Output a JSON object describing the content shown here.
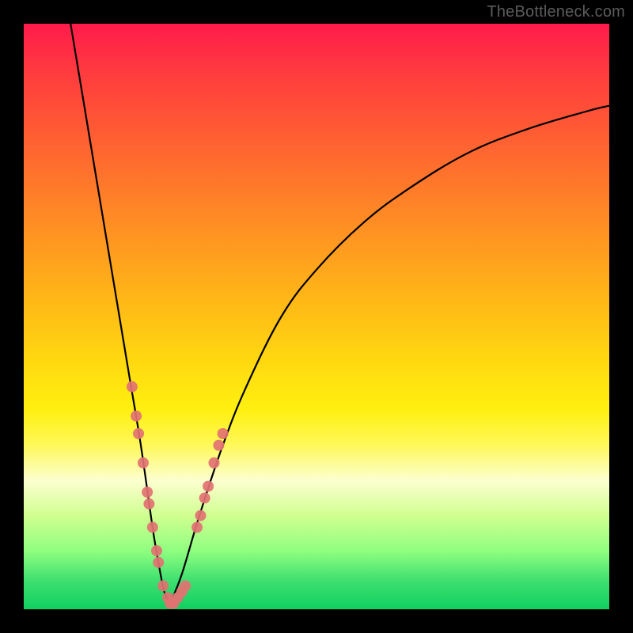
{
  "watermark": "TheBottleneck.com",
  "colors": {
    "frame": "#000000",
    "curve": "#000000",
    "markers": "#e27272",
    "gradient_top": "#ff1b4b",
    "gradient_bottom": "#10d060"
  },
  "chart_data": {
    "type": "line",
    "title": "",
    "xlabel": "",
    "ylabel": "",
    "xlim": [
      0,
      100
    ],
    "ylim": [
      0,
      100
    ],
    "notes": "Two curved branches meeting near a minimum around x≈25; right branch rises and flattens; left branch rises sharply. Pinkish markers cluster on both branches near the minimum, roughly where y is between 2 and 30.",
    "series": [
      {
        "name": "left-branch",
        "x": [
          8,
          10,
          12,
          14,
          16,
          18,
          20,
          22,
          23,
          24,
          25
        ],
        "values": [
          100,
          88,
          76,
          64,
          52,
          40,
          28,
          14,
          8,
          3,
          1
        ]
      },
      {
        "name": "right-branch",
        "x": [
          25,
          27,
          30,
          34,
          38,
          44,
          50,
          58,
          66,
          76,
          86,
          96,
          100
        ],
        "values": [
          1,
          6,
          16,
          28,
          38,
          50,
          58,
          66,
          72,
          78,
          82,
          85,
          86
        ]
      }
    ],
    "markers": [
      {
        "x": 18.5,
        "y": 38
      },
      {
        "x": 19.2,
        "y": 33
      },
      {
        "x": 19.6,
        "y": 30
      },
      {
        "x": 20.4,
        "y": 25
      },
      {
        "x": 21.1,
        "y": 20
      },
      {
        "x": 21.4,
        "y": 18
      },
      {
        "x": 22.0,
        "y": 14
      },
      {
        "x": 22.7,
        "y": 10
      },
      {
        "x": 23.0,
        "y": 8
      },
      {
        "x": 23.8,
        "y": 4
      },
      {
        "x": 24.6,
        "y": 2
      },
      {
        "x": 25.0,
        "y": 1
      },
      {
        "x": 25.6,
        "y": 1
      },
      {
        "x": 26.3,
        "y": 2
      },
      {
        "x": 27.0,
        "y": 3
      },
      {
        "x": 27.6,
        "y": 4
      },
      {
        "x": 29.6,
        "y": 14
      },
      {
        "x": 30.2,
        "y": 16
      },
      {
        "x": 30.9,
        "y": 19
      },
      {
        "x": 31.5,
        "y": 21
      },
      {
        "x": 32.5,
        "y": 25
      },
      {
        "x": 33.3,
        "y": 28
      },
      {
        "x": 34.0,
        "y": 30
      }
    ]
  }
}
